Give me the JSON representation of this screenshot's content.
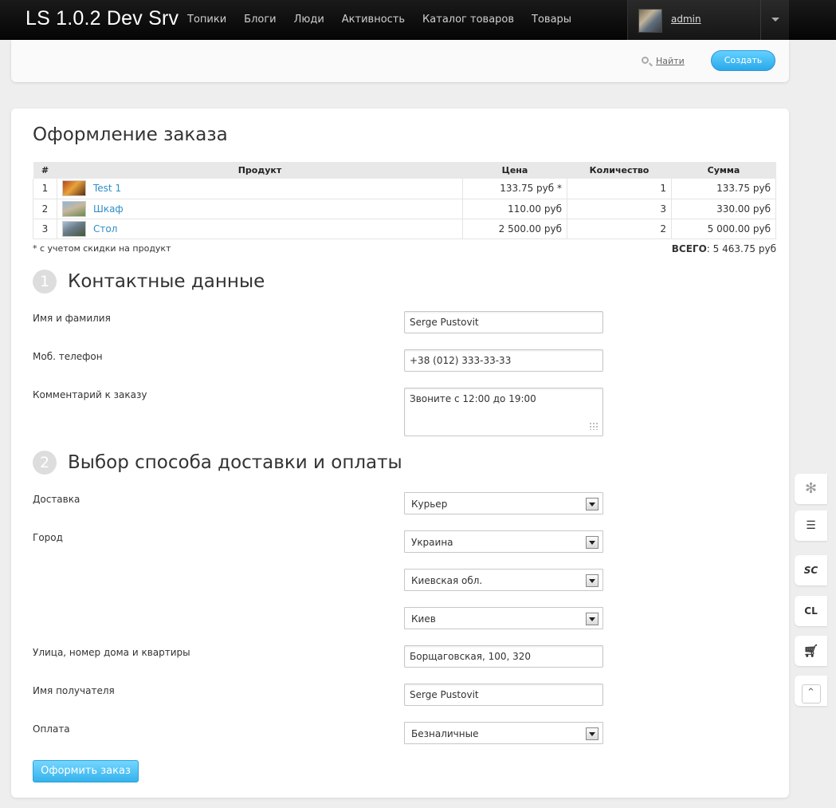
{
  "app": {
    "brand": "LS 1.0.2 Dev Srv"
  },
  "nav": {
    "items": [
      "Топики",
      "Блоги",
      "Люди",
      "Активность",
      "Каталог товаров",
      "Товары"
    ]
  },
  "user": {
    "name": "admin"
  },
  "subbar": {
    "search_label": "Найти",
    "create_label": "Создать"
  },
  "page": {
    "title": "Оформление заказа"
  },
  "order_table": {
    "headers": {
      "num": "#",
      "product": "Продукт",
      "price": "Цена",
      "qty": "Количество",
      "sum": "Сумма"
    },
    "rows": [
      {
        "n": "1",
        "product": "Test 1",
        "price": "133.75 руб *",
        "qty": "1",
        "sum": "133.75 руб"
      },
      {
        "n": "2",
        "product": "Шкаф",
        "price": "110.00 руб",
        "qty": "3",
        "sum": "330.00 руб"
      },
      {
        "n": "3",
        "product": "Стол",
        "price": "2 500.00 руб",
        "qty": "2",
        "sum": "5 000.00 руб"
      }
    ],
    "note": "* с учетом скидки на продукт",
    "total_label": "ВСЕГО",
    "total_value": ": 5 463.75 руб"
  },
  "contact": {
    "step": "1",
    "title": "Контактные данные",
    "name_label": "Имя и фамилия",
    "name_value": "Serge Pustovit",
    "phone_label": "Моб. телефон",
    "phone_value": "+38 (012) 333-33-33",
    "comment_label": "Комментарий к заказу",
    "comment_value": "Звоните с 12:00 до 19:00"
  },
  "delivery": {
    "step": "2",
    "title": "Выбор способа доставки и оплаты",
    "delivery_label": "Доставка",
    "delivery_value": "Курьер",
    "city_label": "Город",
    "country_value": "Украина",
    "region_value": "Киевская обл.",
    "city_value": "Киев",
    "street_label": "Улица, номер дома и квартиры",
    "street_value": "Борщаговская, 100, 320",
    "recipient_label": "Имя получателя",
    "recipient_value": "Serge Pustovit",
    "payment_label": "Оплата",
    "payment_value": "Безналичные"
  },
  "submit": {
    "label": "Оформить заказ"
  },
  "side_tools": {
    "sc": "SC",
    "cl": "CL"
  },
  "icons": [
    "gear-icon",
    "document-icon",
    "cart-icon",
    "chevron-up-icon",
    "search-icon",
    "chevron-down-icon"
  ],
  "colors": {
    "accent": "#35b2ec",
    "link": "#2f8fc7",
    "topbar": "#0a0a0a"
  }
}
